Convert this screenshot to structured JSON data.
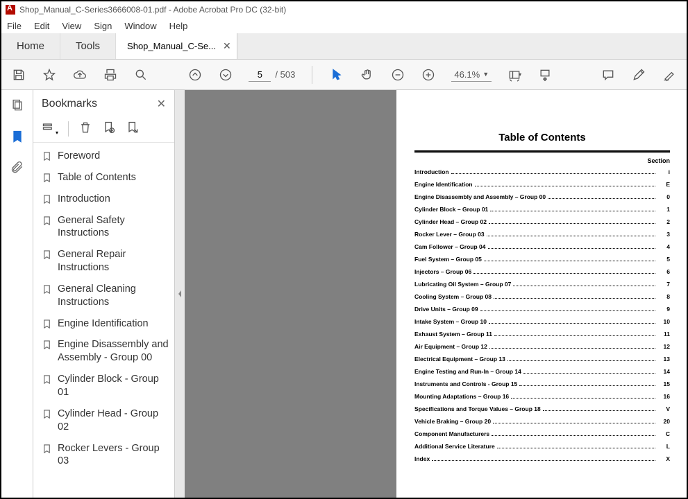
{
  "window": {
    "title": "Shop_Manual_C-Series3666008-01.pdf - Adobe Acrobat Pro DC (32-bit)"
  },
  "menu": {
    "file": "File",
    "edit": "Edit",
    "view": "View",
    "sign": "Sign",
    "window": "Window",
    "help": "Help"
  },
  "tabs": {
    "home": "Home",
    "tools": "Tools",
    "doc": "Shop_Manual_C-Se..."
  },
  "toolbar": {
    "page_current": "5",
    "page_total": "/ 503",
    "zoom": "46.1%"
  },
  "sidebar": {
    "title": "Bookmarks",
    "items": [
      "Foreword",
      "Table of Contents",
      "Introduction",
      "General Safety Instructions",
      "General Repair Instructions",
      "General Cleaning Instructions",
      "Engine Identification",
      "Engine Disassembly and Assembly - Group 00",
      "Cylinder Block - Group 01",
      "Cylinder Head - Group 02",
      "Rocker Levers - Group 03"
    ]
  },
  "toc": {
    "title": "Table of Contents",
    "section_header": "Section",
    "rows": [
      {
        "name": "Introduction",
        "section": "i"
      },
      {
        "name": "Engine Identification",
        "section": "E"
      },
      {
        "name": "Engine Disassembly and Assembly – Group 00",
        "section": "0"
      },
      {
        "name": "Cylinder Block – Group 01",
        "section": "1"
      },
      {
        "name": "Cylinder Head – Group 02",
        "section": "2"
      },
      {
        "name": "Rocker Lever – Group 03",
        "section": "3"
      },
      {
        "name": "Cam Follower – Group 04",
        "section": "4"
      },
      {
        "name": "Fuel System – Group 05",
        "section": "5"
      },
      {
        "name": "Injectors – Group 06",
        "section": "6"
      },
      {
        "name": "Lubricating Oil System – Group 07",
        "section": "7"
      },
      {
        "name": "Cooling System – Group 08",
        "section": "8"
      },
      {
        "name": "Drive Units – Group 09",
        "section": "9"
      },
      {
        "name": "Intake System – Group 10",
        "section": "10"
      },
      {
        "name": "Exhaust System – Group 11",
        "section": "11"
      },
      {
        "name": "Air Equipment – Group 12",
        "section": "12"
      },
      {
        "name": "Electrical Equipment – Group 13",
        "section": "13"
      },
      {
        "name": "Engine Testing and Run-In – Group 14",
        "section": "14"
      },
      {
        "name": "Instruments and Controls - Group 15",
        "section": "15"
      },
      {
        "name": "Mounting Adaptations – Group 16",
        "section": "16"
      },
      {
        "name": "Specifications and Torque Values – Group 18",
        "section": "V"
      },
      {
        "name": "Vehicle Braking – Group 20",
        "section": "20"
      },
      {
        "name": "Component Manufacturers",
        "section": "C"
      },
      {
        "name": "Additional Service Literature",
        "section": "L"
      },
      {
        "name": "Index",
        "section": "X"
      }
    ]
  }
}
